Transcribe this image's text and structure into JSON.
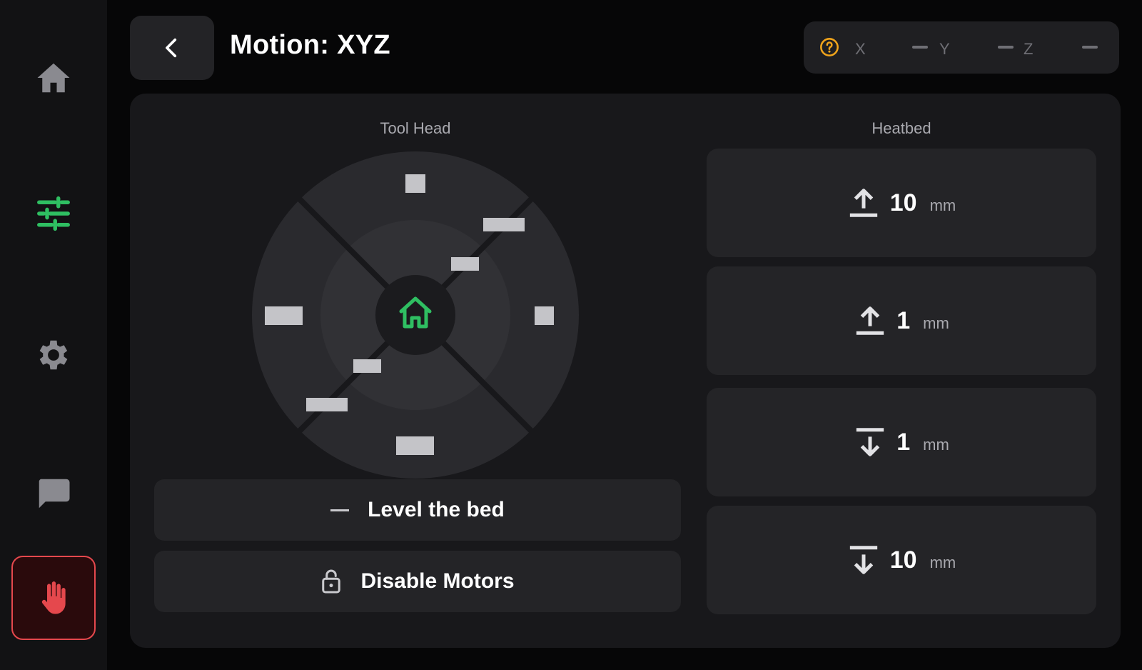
{
  "sidebar": {
    "items": [
      {
        "name": "home",
        "icon": "home-icon"
      },
      {
        "name": "controls",
        "icon": "sliders-icon",
        "active": true
      },
      {
        "name": "settings",
        "icon": "gear-icon"
      },
      {
        "name": "console",
        "icon": "chat-icon"
      },
      {
        "name": "emergency-stop",
        "icon": "hand-stop-icon"
      }
    ]
  },
  "header": {
    "title": "Motion: XYZ",
    "back_icon": "chevron-left-icon"
  },
  "position": {
    "help_icon": "question-circle-icon",
    "x_label": "X",
    "y_label": "Y",
    "z_label": "Z"
  },
  "toolhead": {
    "label": "Tool Head",
    "home_icon": "home-outline-icon"
  },
  "actions": {
    "level_label": "Level the bed",
    "disable_label": "Disable Motors",
    "disable_icon": "unlock-icon"
  },
  "heatbed": {
    "label": "Heatbed",
    "buttons": [
      {
        "value": "10",
        "unit": "mm",
        "direction": "up"
      },
      {
        "value": "1",
        "unit": "mm",
        "direction": "up"
      },
      {
        "value": "1",
        "unit": "mm",
        "direction": "down"
      },
      {
        "value": "10",
        "unit": "mm",
        "direction": "down"
      }
    ]
  },
  "colors": {
    "accent": "#2fbf62",
    "warning": "#f0a41b",
    "danger": "#e5484d",
    "background": "#060607",
    "panel": "#18181b",
    "button": "#242427"
  }
}
